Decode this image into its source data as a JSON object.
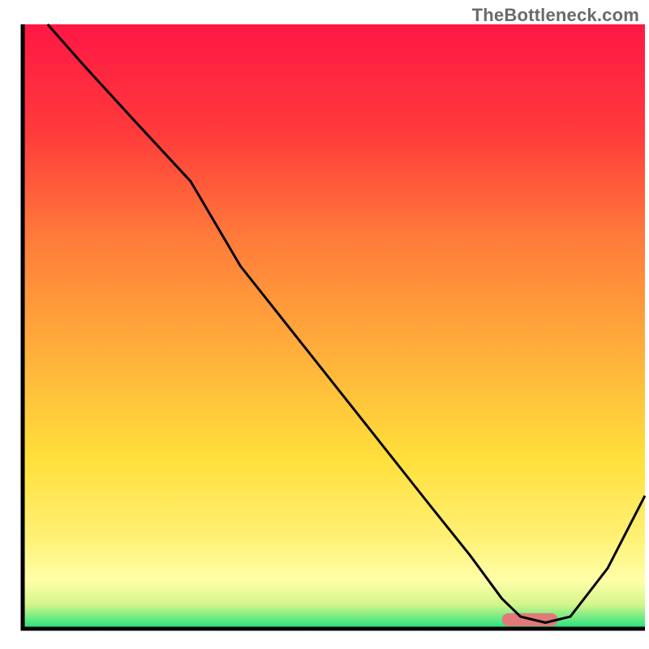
{
  "watermark": "TheBottleneck.com",
  "chart_data": {
    "type": "line",
    "title": "",
    "xlabel": "",
    "ylabel": "",
    "xlim": [
      0,
      100
    ],
    "ylim": [
      0,
      100
    ],
    "series": [
      {
        "name": "curve",
        "x": [
          4,
          10,
          18,
          27,
          35,
          45,
          55,
          65,
          72,
          77,
          80,
          84,
          88,
          94,
          100
        ],
        "values": [
          100,
          93,
          84,
          74,
          60,
          47,
          34,
          21,
          12,
          5,
          2,
          1,
          2,
          10,
          22
        ]
      }
    ],
    "marker": {
      "x_start": 77,
      "x_end": 86,
      "y": 1.5,
      "color": "#e07a7a"
    },
    "gradient_stops": [
      {
        "offset": 0,
        "color": "#ff1744"
      },
      {
        "offset": 18,
        "color": "#ff3b3b"
      },
      {
        "offset": 35,
        "color": "#ff7a3b"
      },
      {
        "offset": 55,
        "color": "#ffb13b"
      },
      {
        "offset": 72,
        "color": "#ffe03b"
      },
      {
        "offset": 85,
        "color": "#fff176"
      },
      {
        "offset": 92,
        "color": "#ffffa8"
      },
      {
        "offset": 96,
        "color": "#d4f58a"
      },
      {
        "offset": 100,
        "color": "#1de27e"
      }
    ],
    "axis_color": "#000000",
    "axis_width": 5
  }
}
